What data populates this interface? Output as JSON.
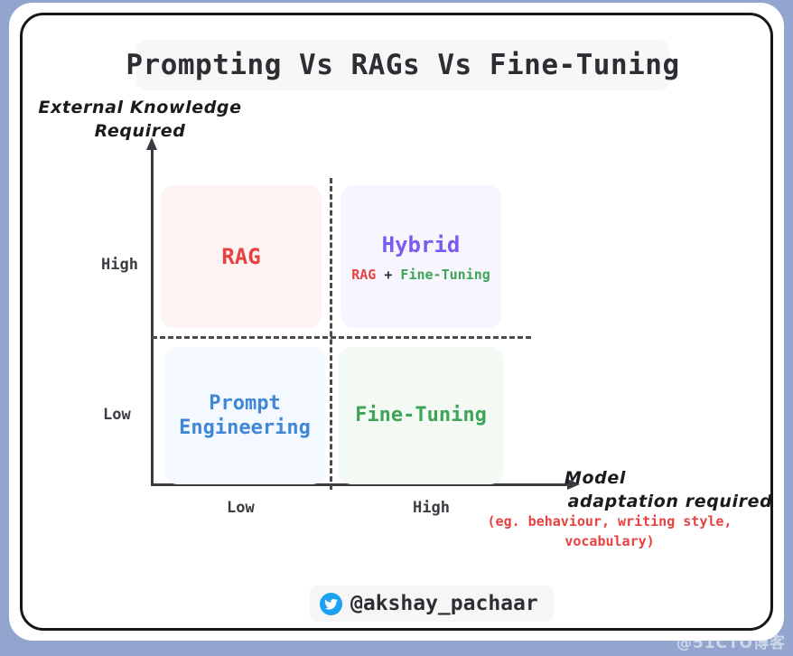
{
  "title": "Prompting Vs RAGs Vs Fine-Tuning",
  "axes": {
    "y_caption_line1": "External Knowledge",
    "y_caption_line2": "Required",
    "y_tick_high": "High",
    "y_tick_low": "Low",
    "x_caption_line1": "Model",
    "x_caption_line2": "adaptation required",
    "x_note_line1": "(eg. behaviour, writing style,",
    "x_note_line2": "vocabulary)",
    "x_tick_low": "Low",
    "x_tick_high": "High"
  },
  "quadrants": {
    "top_left": {
      "label": "RAG",
      "text_color": "#e8413f",
      "bg_color": "#fdf3f3"
    },
    "top_right": {
      "label": "Hybrid",
      "text_color": "#7b5cf0",
      "bg_color": "#f7f5fe",
      "sub_left": "RAG",
      "sub_plus": " + ",
      "sub_right": "Fine-Tuning"
    },
    "bottom_left": {
      "label": "Prompt\nEngineering",
      "text_color": "#4187d8",
      "bg_color": "#f3f9fe"
    },
    "bottom_right": {
      "label": "Fine-Tuning",
      "text_color": "#3fa457",
      "bg_color": "#f3faf4"
    }
  },
  "footer": {
    "icon": "twitter-bird-icon",
    "handle": "@akshay_pachaar"
  },
  "watermark": "@51CTO博客",
  "chart_data": {
    "type": "scatter",
    "title": "Prompting Vs RAGs Vs Fine-Tuning",
    "xlabel": "Model adaptation required (eg. behaviour, writing style, vocabulary)",
    "ylabel": "External Knowledge Required",
    "x_ticks": [
      "Low",
      "High"
    ],
    "y_ticks": [
      "Low",
      "High"
    ],
    "grid": false,
    "legend": "none",
    "quadrant_items": [
      {
        "name": "RAG",
        "x": "Low",
        "y": "High",
        "color": "#e8413f"
      },
      {
        "name": "Hybrid (RAG + Fine-Tuning)",
        "x": "High",
        "y": "High",
        "color": "#7b5cf0"
      },
      {
        "name": "Prompt Engineering",
        "x": "Low",
        "y": "Low",
        "color": "#4187d8"
      },
      {
        "name": "Fine-Tuning",
        "x": "High",
        "y": "Low",
        "color": "#3fa457"
      }
    ]
  }
}
